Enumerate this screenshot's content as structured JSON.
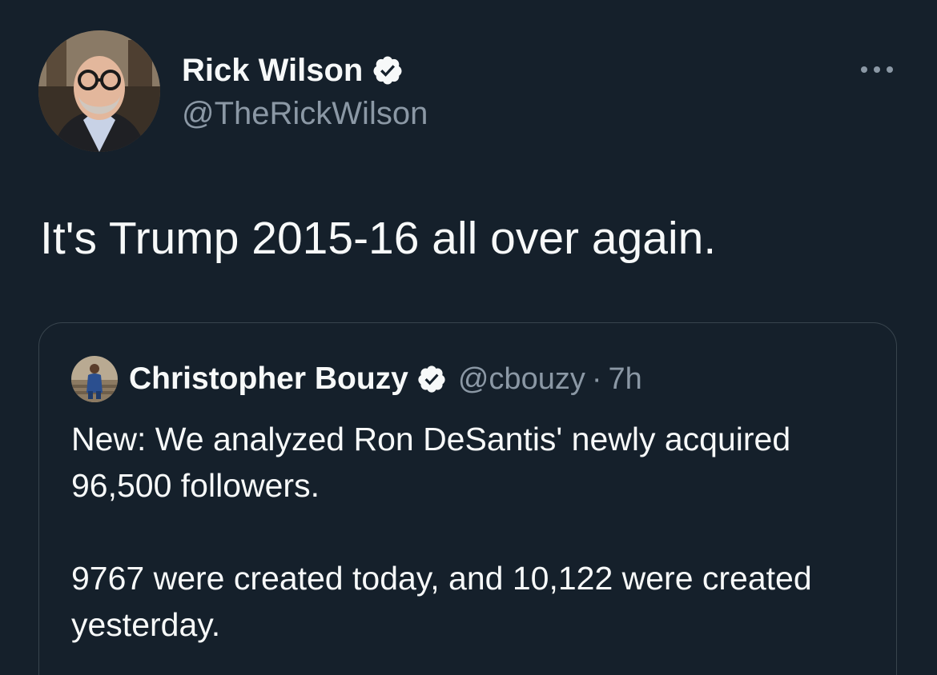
{
  "tweet": {
    "author_name": "Rick Wilson",
    "author_handle": "@TheRickWilson",
    "text": "It's Trump 2015-16 all over again."
  },
  "quoted_tweet": {
    "author_name": "Christopher Bouzy",
    "author_handle": "@cbouzy",
    "separator": "·",
    "time": "7h",
    "paragraphs": [
      "New: We analyzed Ron DeSantis' newly acquired 96,500 followers.",
      "9767 were created today, and 10,122 were created yesterday."
    ]
  },
  "icons": {
    "verified": "verified-badge-icon",
    "more": "more-options-icon"
  },
  "colors": {
    "background": "#15202b",
    "text_primary": "#f7f9f9",
    "text_secondary": "#8b98a5",
    "border": "#38444d"
  }
}
